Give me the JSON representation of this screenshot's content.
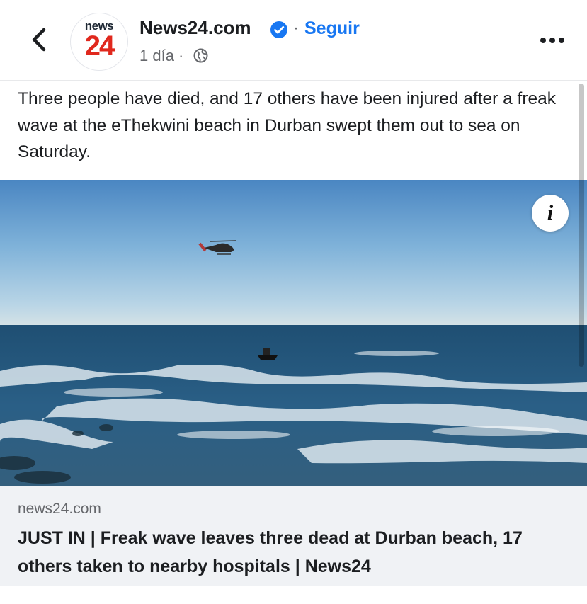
{
  "header": {
    "back_icon": "chevron-left-icon",
    "avatar": {
      "top_text": "news",
      "number": "24"
    },
    "page_name": "News24.com",
    "verified_icon": "verified-badge-icon",
    "separator": "·",
    "follow_label": "Seguir",
    "time": "1 día ·",
    "audience_icon": "globe-icon",
    "more_icon": "more-options-icon"
  },
  "post": {
    "text": "Three people have died, and 17 others have been injured after a freak wave at the eThekwini beach in Durban swept them out to sea on Saturday."
  },
  "image": {
    "info_label": "i"
  },
  "link": {
    "domain": "news24.com",
    "title": "JUST IN | Freak wave leaves three dead at Durban beach, 17 others taken to nearby hospitals | News24"
  },
  "colors": {
    "accent": "#1877f2",
    "brand_red": "#e0281d",
    "link_card_bg": "#f0f2f5"
  }
}
